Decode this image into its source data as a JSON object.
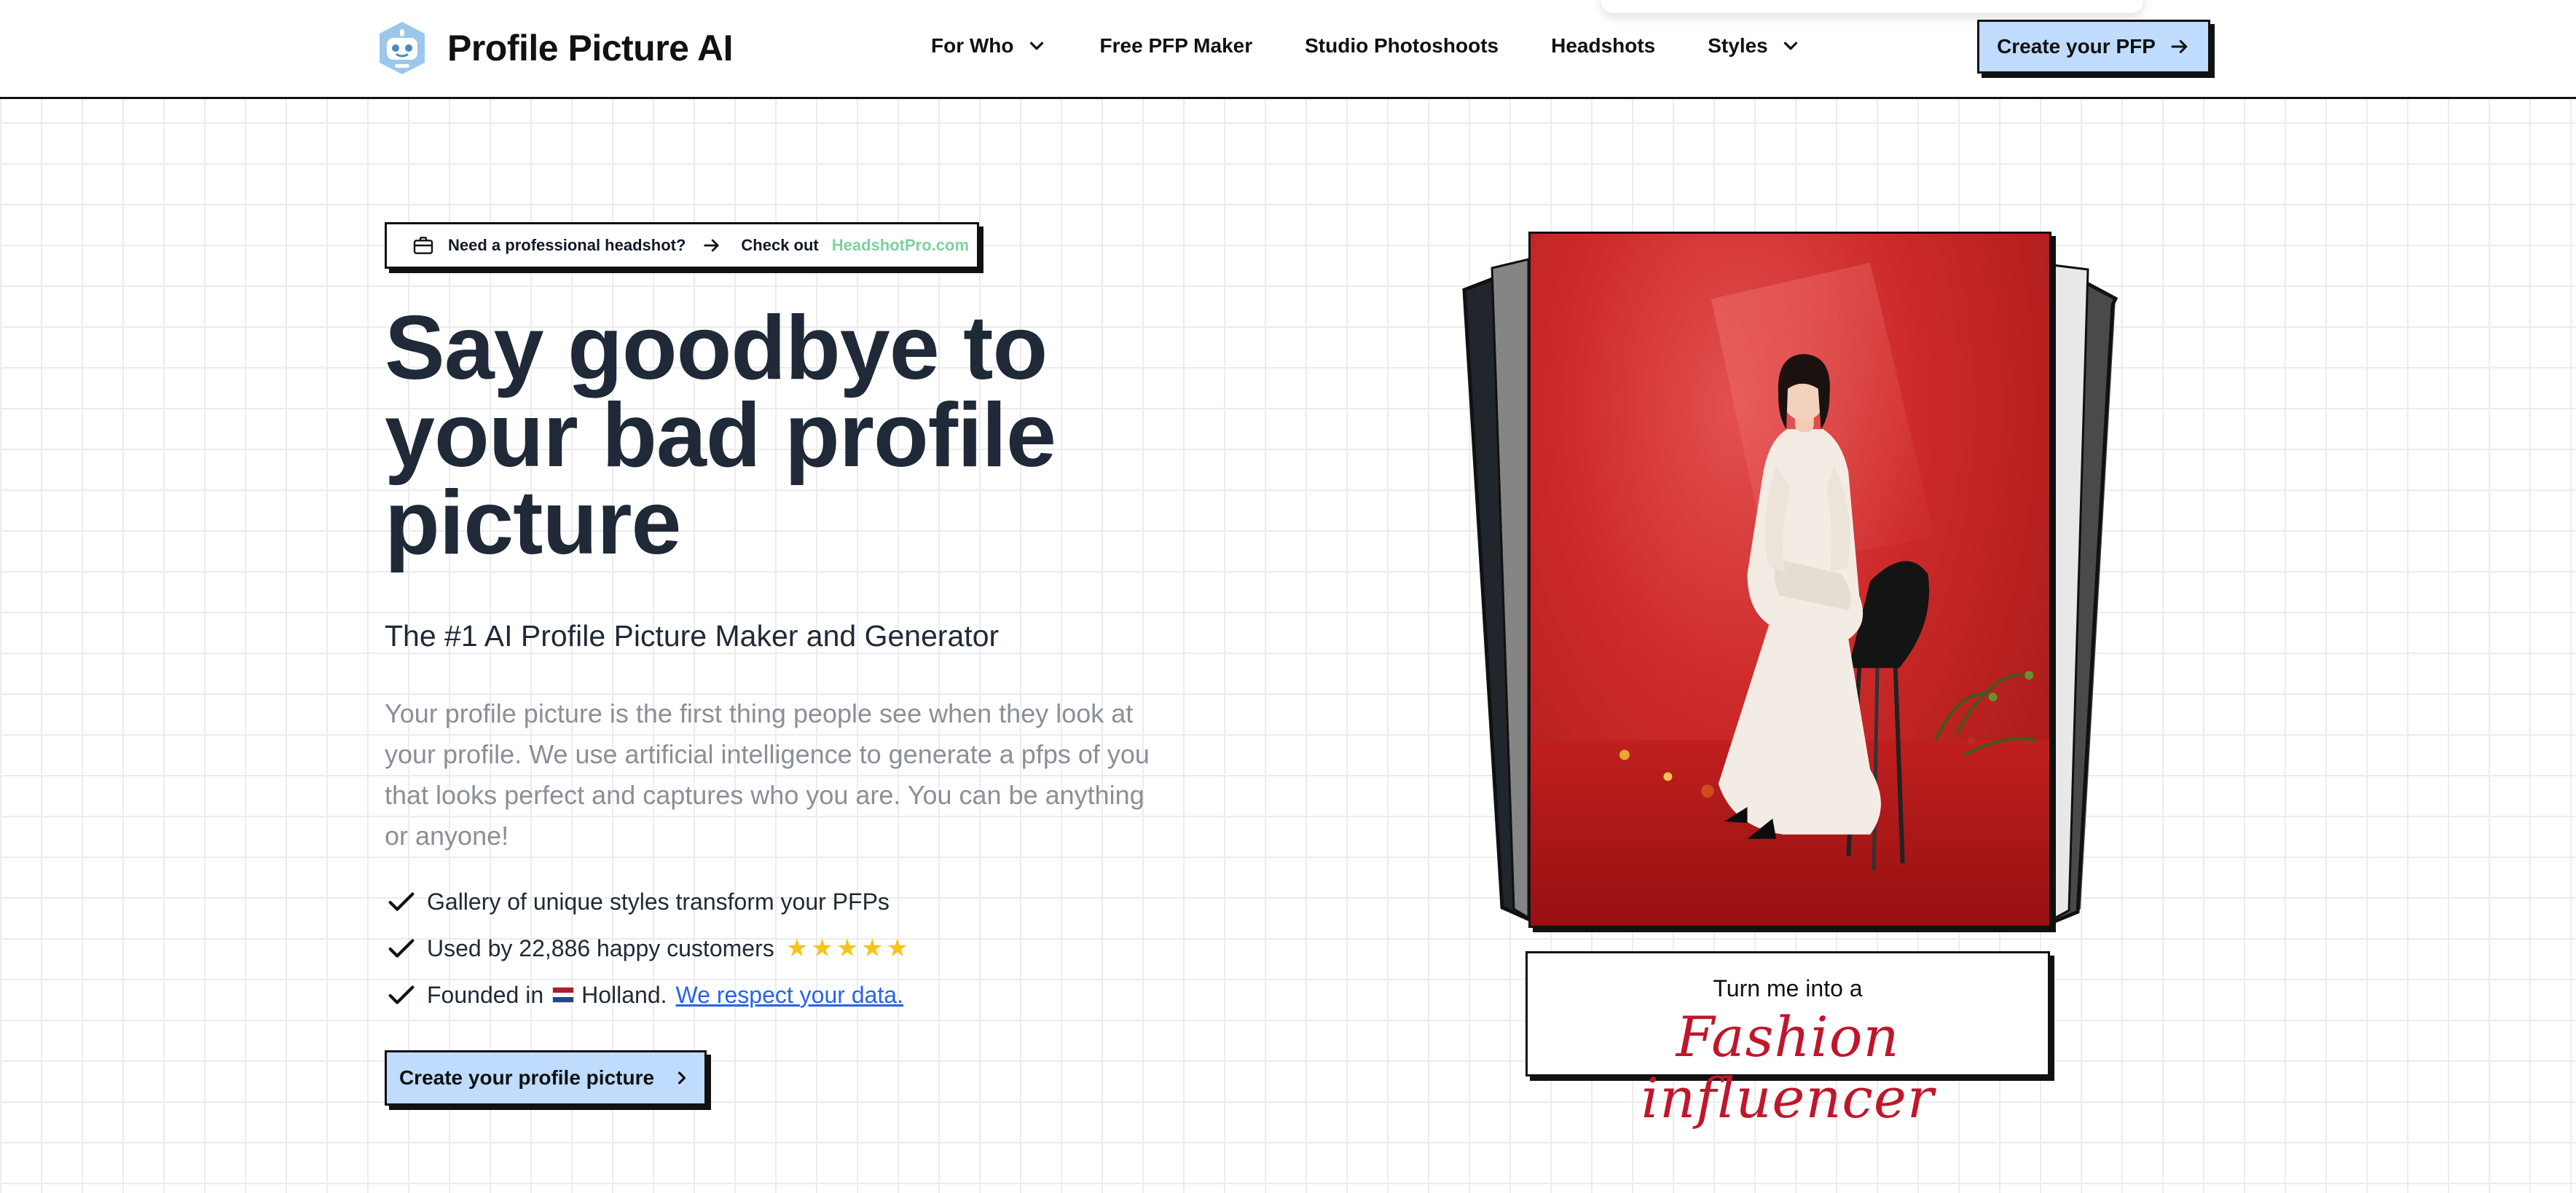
{
  "header": {
    "brand": "Profile Picture AI",
    "logo_icon": "robot-avatar-icon",
    "nav": [
      {
        "label": "For Who",
        "has_dropdown": true
      },
      {
        "label": "Free PFP Maker",
        "has_dropdown": false
      },
      {
        "label": "Studio Photoshoots",
        "has_dropdown": false
      },
      {
        "label": "Headshots",
        "has_dropdown": false
      },
      {
        "label": "Styles",
        "has_dropdown": true
      }
    ],
    "cta_label": "Create your PFP"
  },
  "promo": {
    "icon": "briefcase-icon",
    "text": "Need a professional headshot?",
    "cta_prefix": "Check out",
    "link": "HeadshotPro.com"
  },
  "hero": {
    "title": "Say goodbye to your bad profile picture",
    "subtitle": "The #1 AI Profile Picture Maker and Generator",
    "description": "Your profile picture is the first thing people see when they look at your profile. We use artificial intelligence to generate a pfps of you that looks perfect and captures who you are. You can be anything or anyone!",
    "features": {
      "gallery": "Gallery of unique styles transform your PFPs",
      "customers": "Used by 22,886 happy customers",
      "rating_stars": 5,
      "founded_prefix": "Founded in",
      "founded_country": "Holland.",
      "data_link": "We respect your data."
    },
    "cta_label": "Create your profile picture"
  },
  "showcase": {
    "caption_top": "Turn me into a",
    "caption_style": "Fashion influencer"
  },
  "colors": {
    "accent_button": "#bfdbfe",
    "promo_link": "#7fd19c",
    "star": "#f5c518",
    "link": "#2563eb",
    "caption_red": "#c0162b",
    "photo_red": "#cd2a2a"
  }
}
